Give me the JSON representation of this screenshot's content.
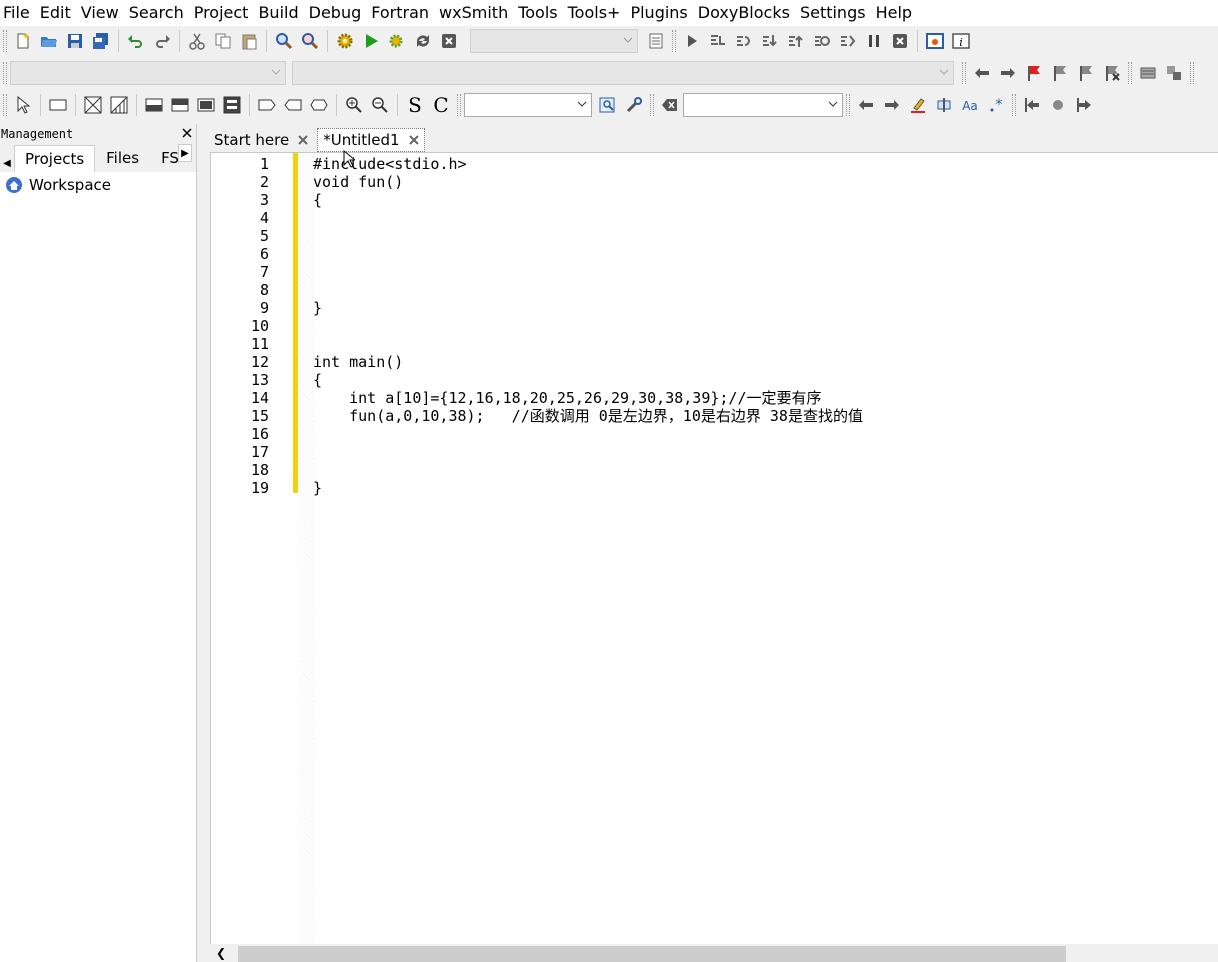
{
  "menu": [
    "File",
    "Edit",
    "View",
    "Search",
    "Project",
    "Build",
    "Debug",
    "Fortran",
    "wxSmith",
    "Tools",
    "Tools+",
    "Plugins",
    "DoxyBlocks",
    "Settings",
    "Help"
  ],
  "management": {
    "title": "Management",
    "tabs": [
      "Projects",
      "Files",
      "FS"
    ],
    "active_tab": "Projects",
    "tree": {
      "workspace_label": "Workspace"
    }
  },
  "editor": {
    "tabs": [
      {
        "label": "Start here",
        "active": false
      },
      {
        "label": "*Untitled1",
        "active": true
      }
    ],
    "lines": [
      {
        "n": "1",
        "code": "#include<stdio.h>"
      },
      {
        "n": "2",
        "code": "void fun()"
      },
      {
        "n": "3",
        "code": "{"
      },
      {
        "n": "4",
        "code": ""
      },
      {
        "n": "5",
        "code": ""
      },
      {
        "n": "6",
        "code": ""
      },
      {
        "n": "7",
        "code": ""
      },
      {
        "n": "8",
        "code": ""
      },
      {
        "n": "9",
        "code": "}"
      },
      {
        "n": "10",
        "code": ""
      },
      {
        "n": "11",
        "code": ""
      },
      {
        "n": "12",
        "code": "int main()"
      },
      {
        "n": "13",
        "code": "{"
      },
      {
        "n": "14",
        "code": "    int a[10]={12,16,18,20,25,26,29,30,38,39};//一定要有序"
      },
      {
        "n": "15",
        "code": "    fun(a,0,10,38);   //函数调用 0是左边界，10是右边界 38是查找的值"
      },
      {
        "n": "16",
        "code": ""
      },
      {
        "n": "17",
        "code": ""
      },
      {
        "n": "18",
        "code": ""
      },
      {
        "n": "19",
        "code": "}"
      }
    ]
  },
  "colors": {
    "change_bar": "#f2d20f",
    "menu_bg": "#ffffff",
    "toolbar_bg": "#f0f0f0"
  }
}
